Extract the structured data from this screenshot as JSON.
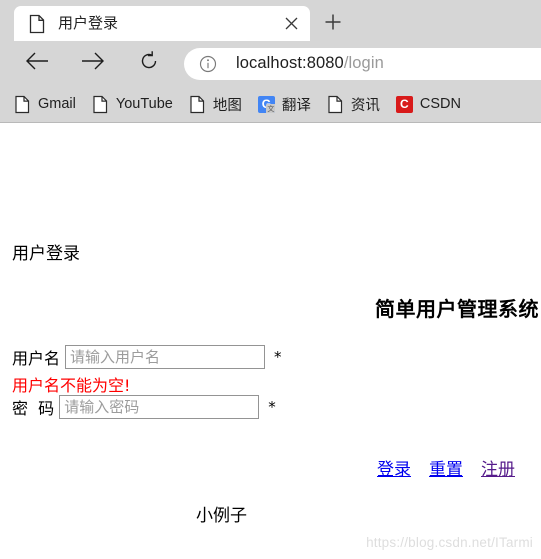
{
  "browser": {
    "tab": {
      "title": "用户登录",
      "favicon_icon": "page-icon",
      "close_icon": "close-icon"
    },
    "new_tab_icon": "plus-icon",
    "toolbar": {
      "back_icon": "arrow-left-icon",
      "forward_icon": "arrow-right-icon",
      "reload_icon": "reload-icon",
      "info_icon": "info-circle-icon",
      "url_host": "localhost:8080",
      "url_path": "/login"
    },
    "bookmarks": [
      {
        "label": "Gmail",
        "icon": "page-icon",
        "icon_type": "page"
      },
      {
        "label": "YouTube",
        "icon": "page-icon",
        "icon_type": "page"
      },
      {
        "label": "地图",
        "icon": "page-icon",
        "icon_type": "page"
      },
      {
        "label": "翻译",
        "icon": "google-translate-icon",
        "icon_type": "square",
        "glyph": "G",
        "sub_glyph": "文",
        "color": "#4285f4"
      },
      {
        "label": "资讯",
        "icon": "page-icon",
        "icon_type": "page"
      },
      {
        "label": "CSDN",
        "icon": "csdn-icon",
        "icon_type": "square",
        "glyph": "C",
        "color": "#d81a1a"
      }
    ]
  },
  "page": {
    "heading": "用户登录",
    "system_title": "简单用户管理系统",
    "form": {
      "username": {
        "label": "用户名",
        "placeholder": "请输入用户名",
        "value": "",
        "required_mark": "*"
      },
      "password": {
        "label": "密  码",
        "placeholder": "请输入密码",
        "value": "",
        "required_mark": "*"
      },
      "error": "用户名不能为空!"
    },
    "links": {
      "login": "登录",
      "reset": "重置",
      "register": "注册"
    },
    "footer_note": "小例子",
    "watermark": "https://blog.csdn.net/ITarmi"
  },
  "colors": {
    "chrome_bg": "#d6d6d6",
    "error": "#ff0000",
    "link": "#0000ee",
    "visited_link": "#551a8b"
  }
}
